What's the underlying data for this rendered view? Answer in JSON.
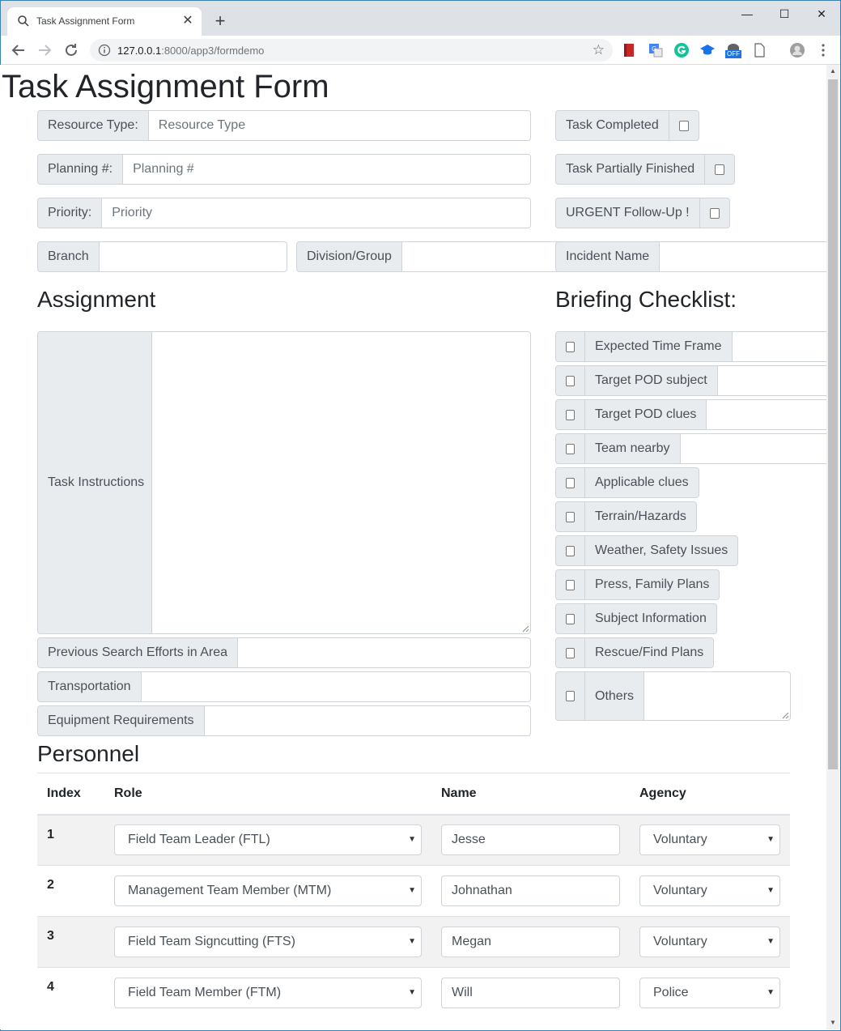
{
  "browser": {
    "tab_title": "Task Assignment Form",
    "url_host": "127.0.0.1",
    "url_rest": ":8000/app3/formdemo",
    "ext_off_badge": "OFF"
  },
  "page": {
    "title": "Task Assignment Form"
  },
  "header_fields": {
    "resource_type": {
      "label": "Resource Type:",
      "placeholder": "Resource Type"
    },
    "planning": {
      "label": "Planning #:",
      "placeholder": "Planning #"
    },
    "priority": {
      "label": "Priority:",
      "placeholder": "Priority"
    },
    "branch": {
      "label": "Branch"
    },
    "division": {
      "label": "Division/Group"
    },
    "incident": {
      "label": "Incident Name"
    }
  },
  "status_checks": {
    "completed": "Task Completed",
    "partial": "Task Partially Finished",
    "urgent": "URGENT Follow-Up !"
  },
  "assignment": {
    "heading": "Assignment",
    "task_instructions": "Task Instructions",
    "previous_search": "Previous Search Efforts in Area",
    "transportation": "Transportation",
    "equipment": "Equipment Requirements"
  },
  "briefing": {
    "heading": "Briefing Checklist:",
    "items": [
      "Expected Time Frame",
      "Target POD subject",
      "Target POD clues",
      "Team nearby",
      "Applicable clues",
      "Terrain/Hazards",
      "Weather, Safety Issues",
      "Press, Family Plans",
      "Subject Information",
      "Rescue/Find Plans",
      "Others"
    ]
  },
  "personnel": {
    "heading": "Personnel",
    "columns": [
      "Index",
      "Role",
      "Name",
      "Agency"
    ],
    "rows": [
      {
        "index": "1",
        "role": "Field Team Leader (FTL)",
        "name": "Jesse",
        "agency": "Voluntary"
      },
      {
        "index": "2",
        "role": "Management Team Member (MTM)",
        "name": "Johnathan",
        "agency": "Voluntary"
      },
      {
        "index": "3",
        "role": "Field Team Signcutting (FTS)",
        "name": "Megan",
        "agency": "Voluntary"
      },
      {
        "index": "4",
        "role": "Field Team Member (FTM)",
        "name": "Will",
        "agency": "Police"
      }
    ]
  }
}
